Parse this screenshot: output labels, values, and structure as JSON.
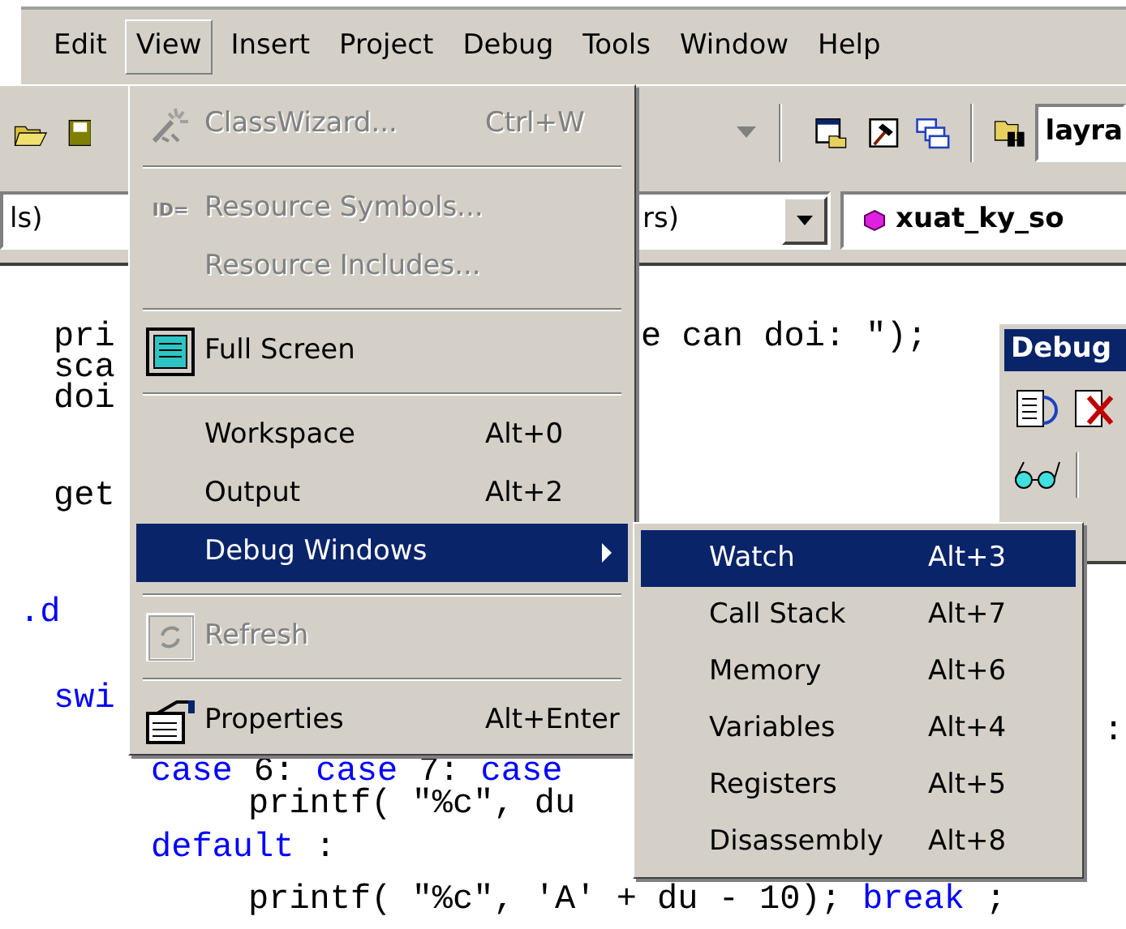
{
  "menu_bar": [
    {
      "label": "Edit",
      "selected": false
    },
    {
      "label": "View",
      "selected": true
    },
    {
      "label": "Insert",
      "selected": false
    },
    {
      "label": "Project",
      "selected": false
    },
    {
      "label": "Debug",
      "selected": false
    },
    {
      "label": "Tools",
      "selected": false
    },
    {
      "label": "Window",
      "selected": false
    },
    {
      "label": "Help",
      "selected": false
    }
  ],
  "toolbar": {
    "find_value": "layra"
  },
  "context_bar": {
    "class_combo": "ls)",
    "members_combo": "rs)",
    "function_combo": "xuat_ky_so"
  },
  "editor": {
    "lines": [
      {
        "left": [
          {
            "text": "pri",
            "kind": "plain"
          }
        ],
        "right": [
          {
            "text": "e can doi: \");",
            "kind": "plain"
          }
        ]
      },
      {
        "left": [
          {
            "text": "sca",
            "kind": "plain"
          }
        ]
      },
      {
        "left": [
          {
            "text": "doi",
            "kind": "plain"
          }
        ]
      },
      {
        "left": [
          {
            "text": "get",
            "kind": "plain"
          }
        ]
      },
      {
        "left": [
          {
            "text": ".d",
            "kind": "keyword"
          }
        ]
      },
      {
        "left": [
          {
            "text": "swi",
            "kind": "keyword"
          }
        ]
      },
      {
        "right": [
          {
            "text": ":",
            "kind": "plain"
          }
        ]
      },
      {
        "left": [
          {
            "text": "case",
            "kind": "keyword"
          },
          {
            "text": "6:",
            "kind": "plain"
          },
          {
            "text": "case",
            "kind": "keyword"
          },
          {
            "text": "7:",
            "kind": "plain"
          },
          {
            "text": "case",
            "kind": "keyword"
          }
        ]
      },
      {
        "left": [
          {
            "text": "printf( \"%c\", du",
            "kind": "plain"
          }
        ]
      },
      {
        "left": [
          {
            "text": "default",
            "kind": "keyword"
          },
          {
            "text": ":",
            "kind": "plain"
          }
        ]
      },
      {
        "left": [
          {
            "text": "printf( \"%c\", 'A' + du - 10);",
            "kind": "plain"
          },
          {
            "text": "break",
            "kind": "keyword"
          },
          {
            "text": ";",
            "kind": "plain"
          }
        ]
      }
    ]
  },
  "debug_toolbar": {
    "title": "Debug"
  },
  "view_menu": [
    {
      "kind": "item",
      "label": "ClassWizard...",
      "shortcut": "Ctrl+W",
      "disabled": true,
      "selected": false
    },
    {
      "kind": "separator"
    },
    {
      "kind": "item",
      "label": "Resource Symbols...",
      "disabled": true,
      "selected": false,
      "icon_text": "ID="
    },
    {
      "kind": "item",
      "label": "Resource Includes...",
      "disabled": true,
      "selected": false
    },
    {
      "kind": "separator"
    },
    {
      "kind": "item",
      "label": "Full Screen",
      "disabled": false,
      "selected": false
    },
    {
      "kind": "separator"
    },
    {
      "kind": "item",
      "label": "Workspace",
      "shortcut": "Alt+0",
      "disabled": false,
      "selected": false
    },
    {
      "kind": "item",
      "label": "Output",
      "shortcut": "Alt+2",
      "disabled": false,
      "selected": false
    },
    {
      "kind": "item",
      "label": "Debug Windows",
      "disabled": false,
      "selected": true,
      "submenu": true
    },
    {
      "kind": "separator"
    },
    {
      "kind": "item",
      "label": "Refresh",
      "disabled": true,
      "selected": false
    },
    {
      "kind": "separator"
    },
    {
      "kind": "item",
      "label": "Properties",
      "shortcut": "Alt+Enter",
      "disabled": false,
      "selected": false
    }
  ],
  "debug_windows_submenu": [
    {
      "label": "Watch",
      "shortcut": "Alt+3",
      "selected": true
    },
    {
      "label": "Call Stack",
      "shortcut": "Alt+7",
      "selected": false
    },
    {
      "label": "Memory",
      "shortcut": "Alt+6",
      "selected": false
    },
    {
      "label": "Variables",
      "shortcut": "Alt+4",
      "selected": false
    },
    {
      "label": "Registers",
      "shortcut": "Alt+5",
      "selected": false
    },
    {
      "label": "Disassembly",
      "shortcut": "Alt+8",
      "selected": false
    }
  ]
}
